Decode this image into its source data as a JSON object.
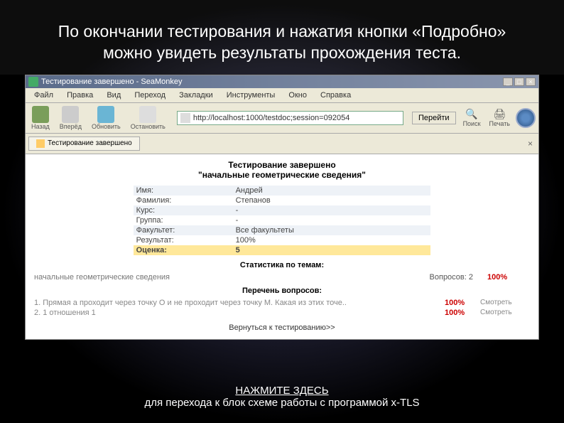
{
  "slide": {
    "title": "По окончании тестирования и нажатия кнопки «Подробно» можно увидеть результаты прохождения теста.",
    "footer_link": "НАЖМИТЕ ЗДЕСЬ",
    "footer_text": "для перехода к блок схеме работы с программой x-TLS"
  },
  "window": {
    "title": "Тестирование завершено - SeaMonkey",
    "minimize": "_",
    "maximize": "□",
    "close": "×"
  },
  "menu": [
    "Файл",
    "Правка",
    "Вид",
    "Переход",
    "Закладки",
    "Инструменты",
    "Окно",
    "Справка"
  ],
  "nav": {
    "back": "Назад",
    "forward": "Вперёд",
    "reload": "Обновить",
    "stop": "Остановить",
    "go": "Перейти",
    "search": "Поиск",
    "print": "Печать"
  },
  "url": "http://localhost:1000/testdoc;session=092054",
  "tab": {
    "label": "Тестирование завершено",
    "close": "×"
  },
  "test": {
    "header1": "Тестирование завершено",
    "header2": "\"начальные геометрические сведения\"",
    "rows": [
      {
        "label": "Имя:",
        "value": "Андрей"
      },
      {
        "label": "Фамилия:",
        "value": "Степанов"
      },
      {
        "label": "Курс:",
        "value": "-"
      },
      {
        "label": "Группа:",
        "value": "-"
      },
      {
        "label": "Факультет:",
        "value": "Все факультеты"
      },
      {
        "label": "Результат:",
        "value": "100%"
      }
    ],
    "grade_label": "Оценка:",
    "grade_value": "5"
  },
  "stats": {
    "header": "Статистика по темам:",
    "topic": "начальные геометрические сведения",
    "questions": "Вопросов: 2",
    "percent": "100%"
  },
  "questions": {
    "header": "Перечень вопросов:",
    "items": [
      {
        "text": "1. Прямая а проходит через точку О и не проходит через точку М. Какая из этих точе..",
        "pct": "100%",
        "action": "Смотреть"
      },
      {
        "text": "2. 1 отношения 1",
        "pct": "100%",
        "action": "Смотреть"
      }
    ]
  },
  "return_link": "Вернуться к тестированию>>"
}
